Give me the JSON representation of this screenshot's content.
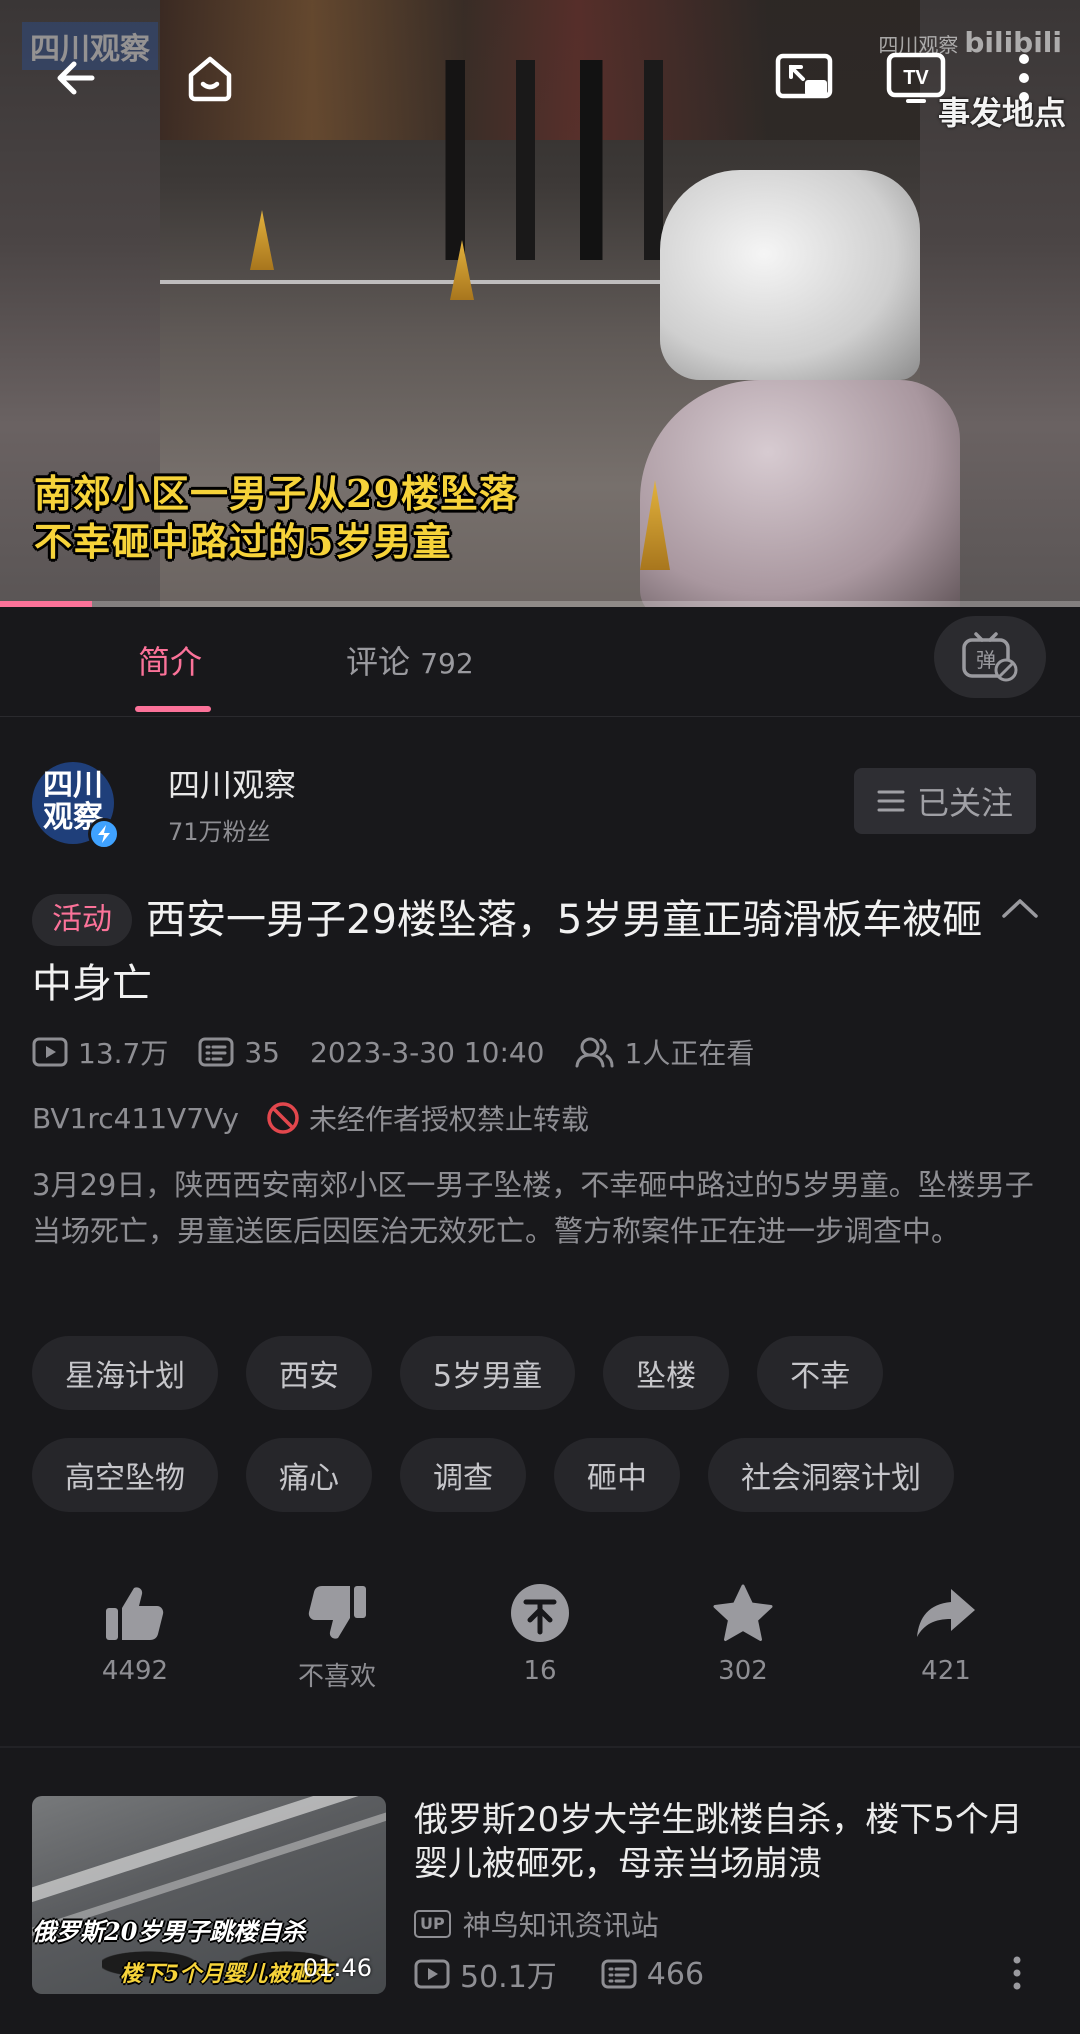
{
  "player": {
    "caption_line1": "南郊小区一男子从29楼坠落",
    "caption_line2": "不幸砸中路过的5岁男童",
    "watermark_left": "四川观察",
    "watermark_right": "四川观察",
    "watermark_brand": "bilibili",
    "watermark_location": "事发地点",
    "progress": 0.085
  },
  "tabs": [
    {
      "label": "简介",
      "active": true
    },
    {
      "label": "评论",
      "count": "792",
      "active": false
    }
  ],
  "uploader": {
    "avatar_text_top": "四川",
    "avatar_text_bottom": "观察",
    "name": "四川观察",
    "fans": "71万粉丝",
    "follow_label": "已关注"
  },
  "video": {
    "activity_tag": "活动",
    "title": "西安一男子29楼坠落，5岁男童正骑滑板车被砸中身亡",
    "views": "13.7万",
    "danmaku": "35",
    "date": "2023-3-30 10:40",
    "watching": "1人正在看",
    "bvid": "BV1rc411V7Vy",
    "copyright": "未经作者授权禁止转载",
    "description": "3月29日，陕西西安南郊小区一男子坠楼，不幸砸中路过的5岁男童。坠楼男子当场死亡，男童送医后因医治无效死亡。警方称案件正在进一步调查中。"
  },
  "tags_row1": [
    "星海计划",
    "西安",
    "5岁男童",
    "坠楼",
    "不幸"
  ],
  "tags_row2": [
    "高空坠物",
    "痛心",
    "调查",
    "砸中",
    "社会洞察计划"
  ],
  "actions": {
    "like": "4492",
    "dislike": "不喜欢",
    "coin": "16",
    "favorite": "302",
    "share": "421"
  },
  "recommended": {
    "thumb_text1": "俄罗斯20岁男子跳楼自杀",
    "thumb_text2": "楼下5个月婴儿被砸死",
    "duration": "01:46",
    "title": "俄罗斯20岁大学生跳楼自杀，楼下5个月婴儿被砸死，母亲当场崩溃",
    "up_tag": "UP",
    "uploader": "神鸟知讯资讯站",
    "views": "50.1万",
    "danmaku": "466"
  },
  "colors": {
    "accent": "#fb7299",
    "background": "#18181b",
    "muted": "#8e8e93"
  }
}
